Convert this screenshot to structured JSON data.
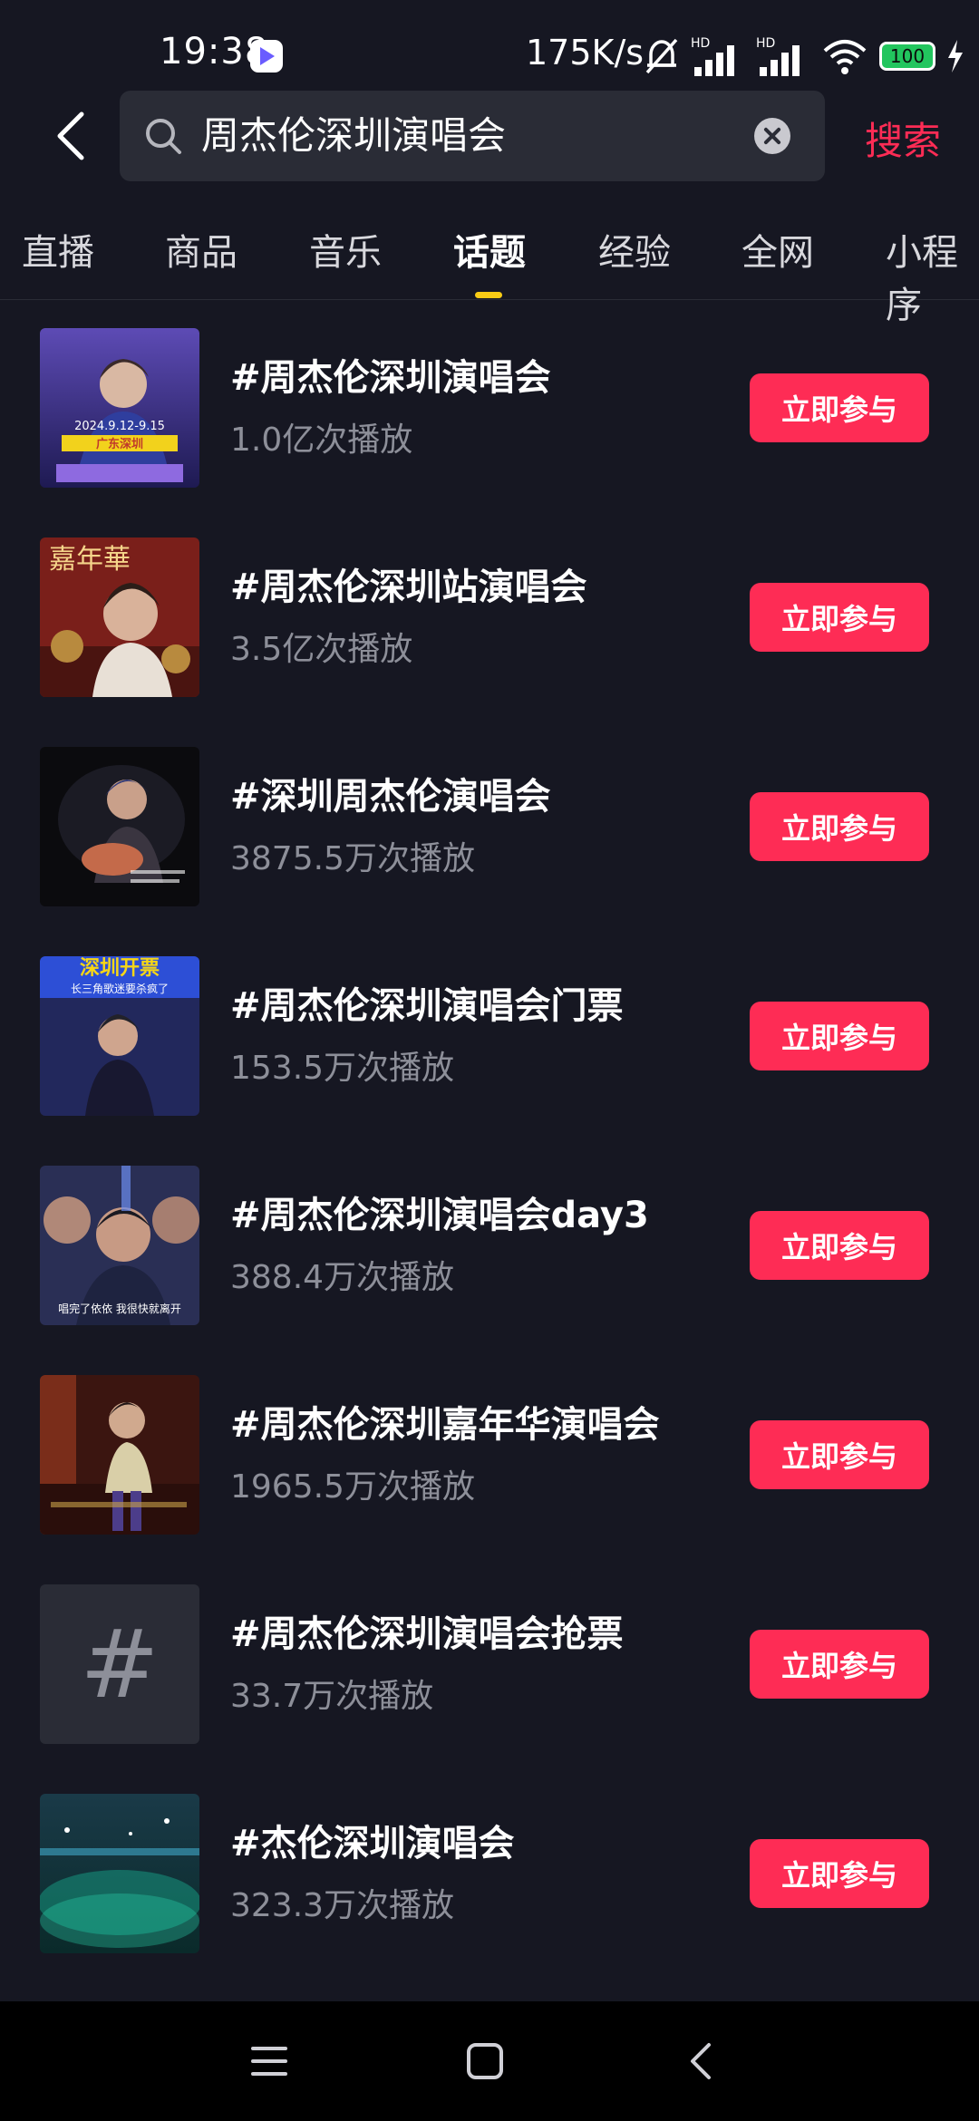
{
  "status_bar": {
    "time": "19:38",
    "net_speed": "175K/s",
    "battery": "100"
  },
  "search": {
    "query": "周杰伦深圳演唱会",
    "action_label": "搜索"
  },
  "tabs": [
    {
      "label": "直播"
    },
    {
      "label": "商品"
    },
    {
      "label": "音乐"
    },
    {
      "label": "话题"
    },
    {
      "label": "经验"
    },
    {
      "label": "全网"
    },
    {
      "label": "小程序"
    }
  ],
  "topics": [
    {
      "title": "#周杰伦深圳演唱会",
      "plays": "1.0亿次播放",
      "action": "立即参与"
    },
    {
      "title": "#周杰伦深圳站演唱会",
      "plays": "3.5亿次播放",
      "action": "立即参与"
    },
    {
      "title": "#深圳周杰伦演唱会",
      "plays": "3875.5万次播放",
      "action": "立即参与"
    },
    {
      "title": "#周杰伦深圳演唱会门票",
      "plays": "153.5万次播放",
      "action": "立即参与"
    },
    {
      "title": "#周杰伦深圳演唱会day3",
      "plays": "388.4万次播放",
      "action": "立即参与"
    },
    {
      "title": "#周杰伦深圳嘉年华演唱会",
      "plays": "1965.5万次播放",
      "action": "立即参与"
    },
    {
      "title": "#周杰伦深圳演唱会抢票",
      "plays": "33.7万次播放",
      "action": "立即参与"
    },
    {
      "title": "#杰伦深圳演唱会",
      "plays": "323.3万次播放",
      "action": "立即参与"
    }
  ],
  "thumb_texts": {
    "t1_date": "2024.9.12-9.15",
    "t1_place": "广东深圳",
    "t2_title": "嘉年華",
    "t4_top": "深圳开票",
    "t4_sub": "长三角歌迷要杀疯了",
    "t5_caption": "唱完了依依 我很快就离开",
    "hash_symbol": "#"
  },
  "colors": {
    "background": "#161722",
    "accent": "#fe2c55",
    "tab_indicator": "#facc15",
    "muted_text": "#8d8f99"
  }
}
